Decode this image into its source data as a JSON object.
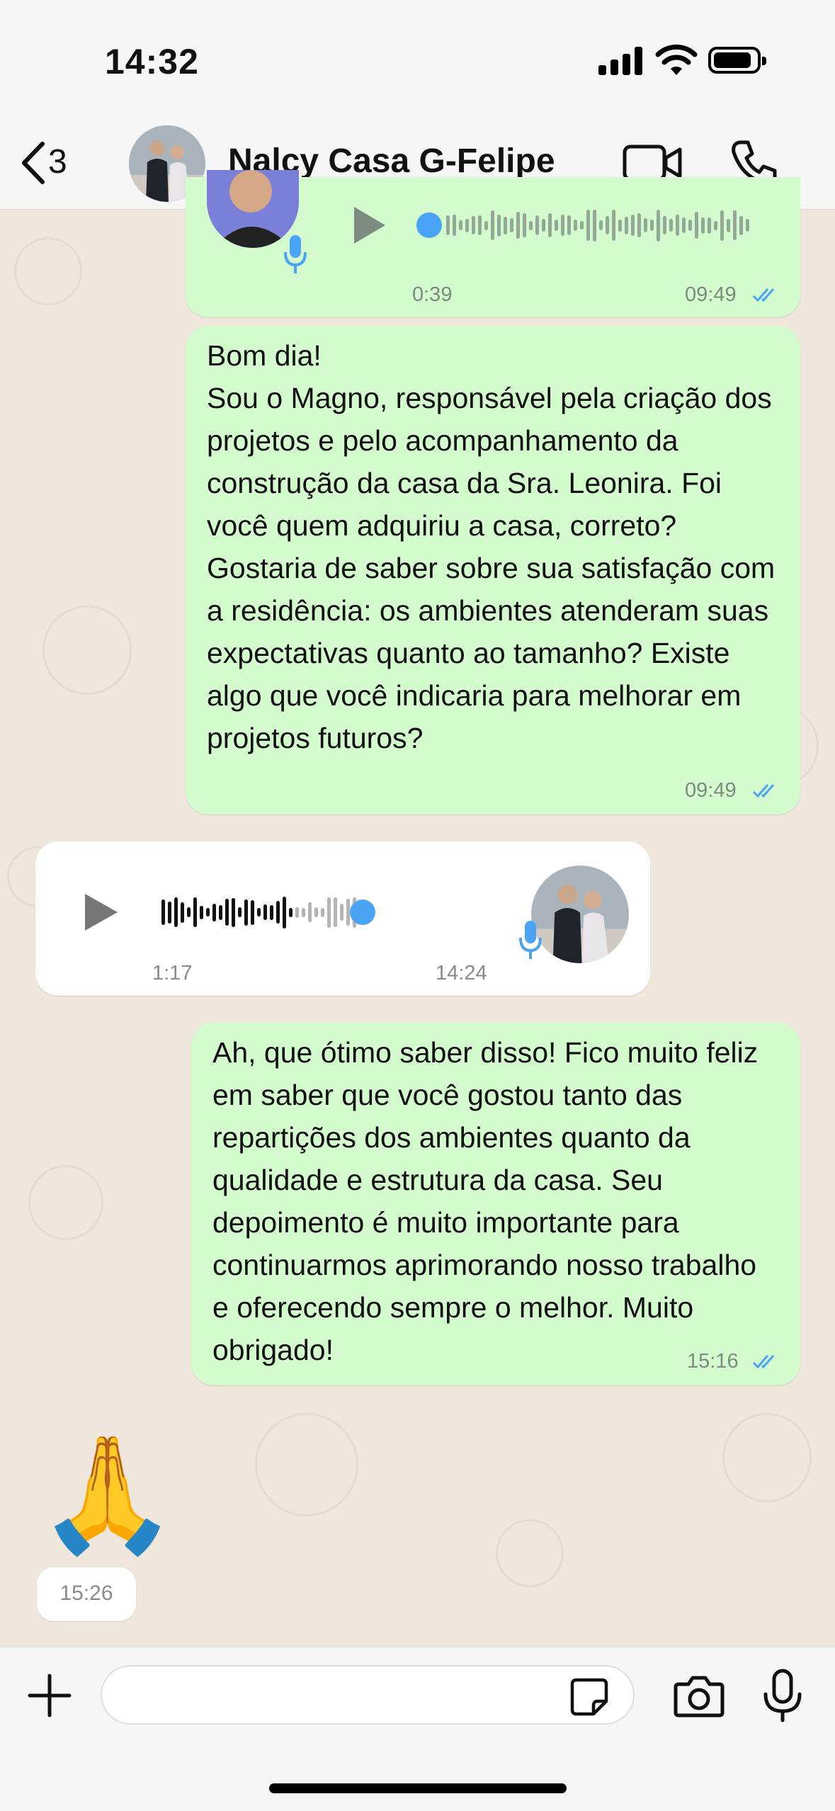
{
  "status_bar": {
    "time": "14:32"
  },
  "header": {
    "back_count": "3",
    "contact_name": "Nalcy Casa G-Felipe"
  },
  "messages": [
    {
      "kind": "audio-out",
      "duration": "0:39",
      "time": "09:49",
      "read": true
    },
    {
      "kind": "text-out",
      "text": "Bom dia!\nSou o Magno, responsável pela criação dos projetos e pelo acompanhamento da construção da casa da Sra. Leonira. Foi você quem adquiriu a casa, correto? Gostaria de saber sobre sua satisfação com a residência: os ambientes atenderam suas expectativas quanto ao tamanho? Existe algo que você indicaria para melhorar em projetos futuros?",
      "time": "09:49",
      "read": true
    },
    {
      "kind": "audio-in",
      "duration": "1:17",
      "time": "14:24",
      "progress": 0.63
    },
    {
      "kind": "text-out",
      "text": "Ah, que ótimo saber disso! Fico muito feliz em saber que você gostou tanto das repartições dos ambientes quanto da qualidade e estrutura da casa. Seu depoimento é muito importante para continuarmos aprimorando nosso trabalho e oferecendo sempre o melhor. Muito obrigado!",
      "time": "15:16",
      "read": true
    },
    {
      "kind": "emoji-in",
      "emoji": "🙏",
      "time": "15:26"
    }
  ],
  "composer": {
    "placeholder": ""
  },
  "colors": {
    "outgoing_bubble": "#d4fbce",
    "incoming_bubble": "#ffffff",
    "read_ticks": "#4aa3f5",
    "chat_background": "#efe7db"
  },
  "icons": [
    "back-chevron-icon",
    "video-call-icon",
    "phone-icon",
    "play-icon",
    "microphone-icon",
    "read-ticks-icon",
    "plus-icon",
    "sticker-icon",
    "camera-icon"
  ]
}
